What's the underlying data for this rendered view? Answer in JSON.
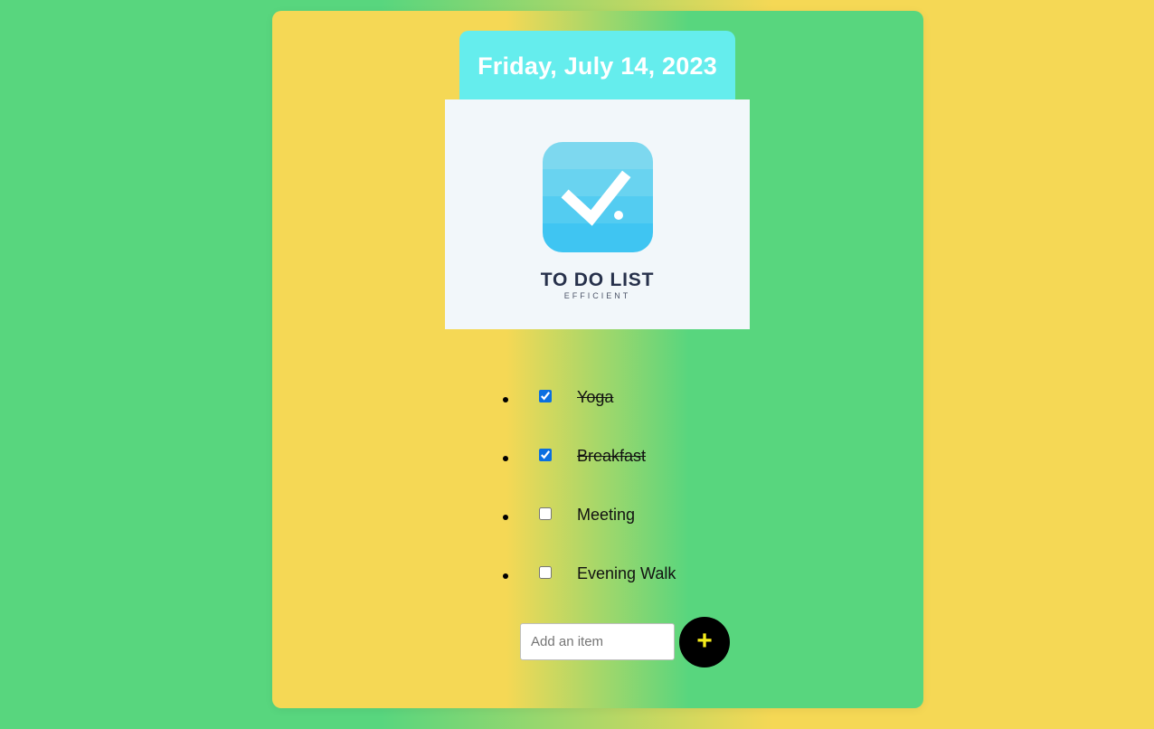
{
  "header": {
    "date": "Friday, July 14, 2023"
  },
  "logo": {
    "title": "TO DO LIST",
    "subtitle": "EFFICIENT",
    "icon": "checkmark-icon"
  },
  "todos": [
    {
      "label": "Yoga",
      "checked": true
    },
    {
      "label": "Breakfast",
      "checked": true
    },
    {
      "label": "Meeting",
      "checked": false
    },
    {
      "label": "Evening Walk",
      "checked": false
    }
  ],
  "add_form": {
    "placeholder": "Add an item",
    "value": "",
    "button_label": "+"
  },
  "colors": {
    "green": "#58d67e",
    "yellow": "#f5d855",
    "date_tab": "#65eded",
    "logo_blue": "#45c8f0",
    "add_button": "#000000",
    "add_button_plus": "#f5ec1c"
  }
}
